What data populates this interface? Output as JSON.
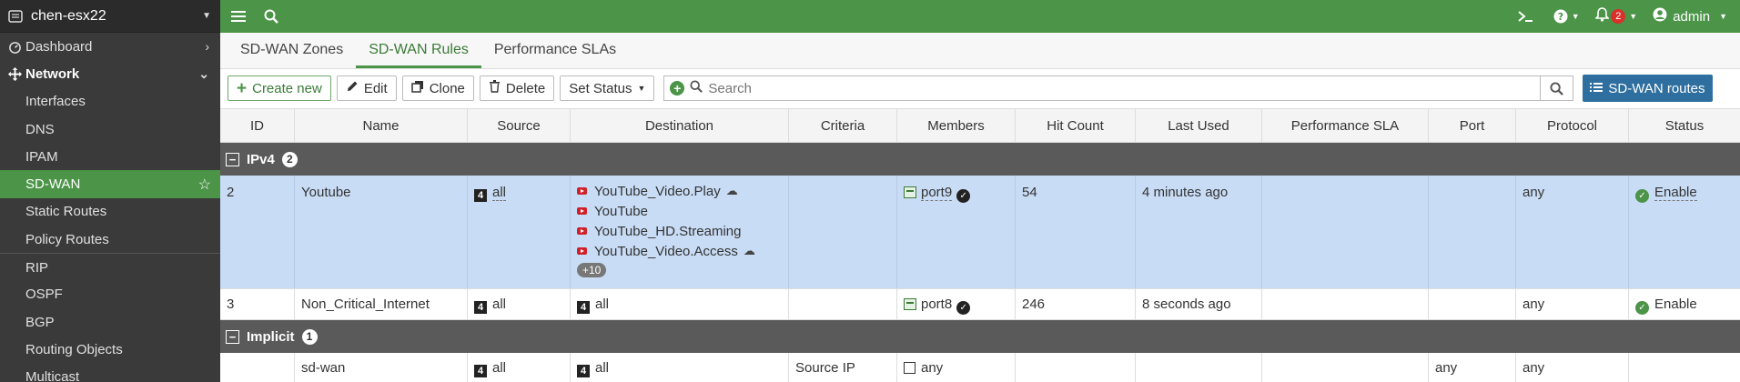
{
  "device": {
    "name": "chen-esx22"
  },
  "sidebar": {
    "dashboard": "Dashboard",
    "network": "Network",
    "items": [
      "Interfaces",
      "DNS",
      "IPAM",
      "SD-WAN",
      "Static Routes",
      "Policy Routes",
      "RIP",
      "OSPF",
      "BGP",
      "Routing Objects",
      "Multicast"
    ],
    "active": "SD-WAN"
  },
  "topbar": {
    "notification_count": "2",
    "user": "admin"
  },
  "tabs": [
    "SD-WAN Zones",
    "SD-WAN Rules",
    "Performance SLAs"
  ],
  "active_tab": "SD-WAN Rules",
  "toolbar": {
    "create": "Create new",
    "edit": "Edit",
    "clone": "Clone",
    "delete": "Delete",
    "set_status": "Set Status",
    "search_placeholder": "Search",
    "routes": "SD-WAN routes"
  },
  "columns": [
    "ID",
    "Name",
    "Source",
    "Destination",
    "Criteria",
    "Members",
    "Hit Count",
    "Last Used",
    "Performance SLA",
    "Port",
    "Protocol",
    "Status"
  ],
  "groups": [
    {
      "name": "IPv4",
      "count": "2",
      "rows": [
        {
          "id": "2",
          "name": "Youtube",
          "source": "all",
          "destinations": [
            "YouTube_Video.Play",
            "YouTube",
            "YouTube_HD.Streaming",
            "YouTube_Video.Access"
          ],
          "more": "+10",
          "criteria": "",
          "member": "port9",
          "hit_count": "54",
          "last_used": "4 minutes ago",
          "sla": "",
          "port": "",
          "protocol": "any",
          "status": "Enable"
        },
        {
          "id": "3",
          "name": "Non_Critical_Internet",
          "source": "all",
          "destination": "all",
          "criteria": "",
          "member": "port8",
          "hit_count": "246",
          "last_used": "8 seconds ago",
          "sla": "",
          "port": "",
          "protocol": "any",
          "status": "Enable"
        }
      ]
    },
    {
      "name": "Implicit",
      "count": "1",
      "rows": [
        {
          "id": "",
          "name": "sd-wan",
          "source": "all",
          "destination": "all",
          "criteria": "Source IP",
          "member": "any",
          "hit_count": "",
          "last_used": "",
          "sla": "",
          "port": "any",
          "protocol": "any",
          "status": ""
        }
      ]
    }
  ],
  "colors": {
    "brand_green": "#4b9448",
    "selected_row": "#c8dcf5",
    "routes_button": "#2e6f9f"
  }
}
